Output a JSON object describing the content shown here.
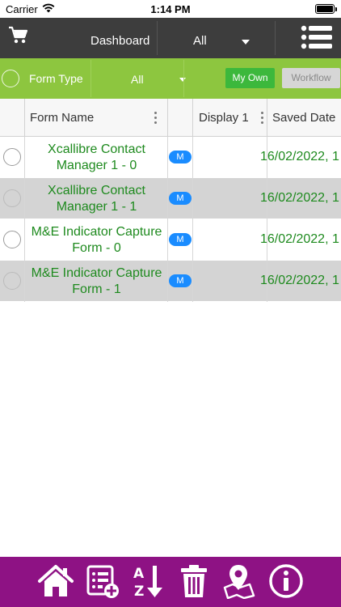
{
  "status_bar": {
    "carrier": "Carrier",
    "time": "1:14 PM",
    "battery_level": 1.0
  },
  "header": {
    "cart_icon": "cart-icon",
    "dashboard_label": "Dashboard",
    "filter_value": "All",
    "menu_icon": "list-menu-icon"
  },
  "filter_bar": {
    "form_type_label": "Form Type",
    "form_type_value": "All",
    "my_own_label": "My Own",
    "workflow_label": "Workflow"
  },
  "table": {
    "columns": [
      "Form Name",
      "Display 1",
      "Saved Date"
    ],
    "rows": [
      {
        "form_name": "Xcallibre Contact Manager 1 - 0",
        "badge": "M",
        "saved_date": "16/02/2022, 1"
      },
      {
        "form_name": "Xcallibre Contact Manager 1 - 1",
        "badge": "M",
        "saved_date": "16/02/2022, 1"
      },
      {
        "form_name": "M&E Indicator Capture Form - 0",
        "badge": "M",
        "saved_date": "16/02/2022, 1"
      },
      {
        "form_name": "M&E Indicator Capture Form - 1",
        "badge": "M",
        "saved_date": "16/02/2022, 1"
      }
    ]
  },
  "bottom_bar": {
    "icons": [
      "home-icon",
      "new-form-icon",
      "sort-az-icon",
      "trash-icon",
      "map-location-icon",
      "info-icon"
    ]
  },
  "colors": {
    "header_bg": "#3d3d3d",
    "filter_bg": "#8dc63f",
    "my_own_bg": "#3cb83c",
    "form_text": "#1e8a1e",
    "badge_bg": "#1a8cff",
    "bottom_bar_bg": "#8e1284"
  }
}
